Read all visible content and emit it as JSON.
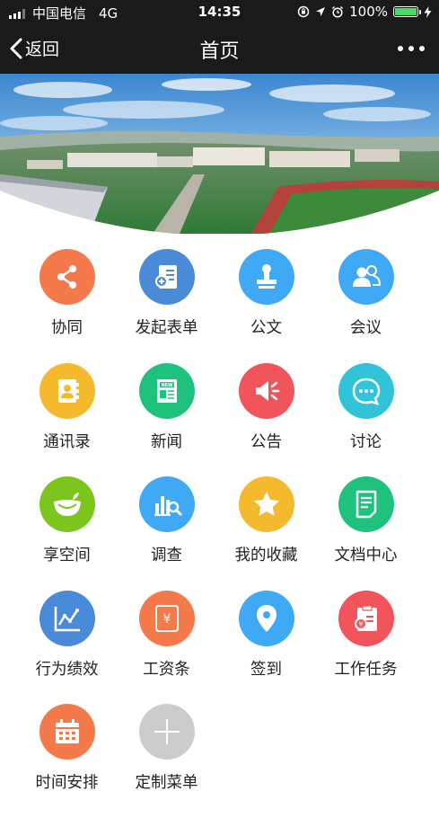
{
  "status": {
    "carrier": "中国电信",
    "network": "4G",
    "time": "14:35",
    "battery": "100%",
    "battery_level": 1.0
  },
  "nav": {
    "back_label": "返回",
    "title": "首页"
  },
  "colors": {
    "bar": "#1a1a1a",
    "battery_fill": "#4cd964"
  },
  "apps": [
    {
      "label": "协同",
      "icon": "share-icon",
      "color": "#f47a4b"
    },
    {
      "label": "发起表单",
      "icon": "form-icon",
      "color": "#4a8bd9"
    },
    {
      "label": "公文",
      "icon": "stamp-icon",
      "color": "#3fa9f5"
    },
    {
      "label": "会议",
      "icon": "people-icon",
      "color": "#3fa9f5"
    },
    {
      "label": "通讯录",
      "icon": "contacts-icon",
      "color": "#f5b92e"
    },
    {
      "label": "新闻",
      "icon": "news-icon",
      "color": "#1ec27d"
    },
    {
      "label": "公告",
      "icon": "megaphone-icon",
      "color": "#f2545b"
    },
    {
      "label": "讨论",
      "icon": "chat-icon",
      "color": "#31c3d9"
    },
    {
      "label": "享空间",
      "icon": "space-icon",
      "color": "#7cc51c"
    },
    {
      "label": "调查",
      "icon": "survey-icon",
      "color": "#3fa9f5"
    },
    {
      "label": "我的收藏",
      "icon": "star-icon",
      "color": "#f5b92e"
    },
    {
      "label": "文档中心",
      "icon": "document-icon",
      "color": "#1ec27d"
    },
    {
      "label": "行为绩效",
      "icon": "performance-icon",
      "color": "#4a8bd9"
    },
    {
      "label": "工资条",
      "icon": "salary-icon",
      "color": "#f47a4b"
    },
    {
      "label": "签到",
      "icon": "location-icon",
      "color": "#3fa9f5"
    },
    {
      "label": "工作任务",
      "icon": "task-icon",
      "color": "#f2545b"
    },
    {
      "label": "时间安排",
      "icon": "calendar-icon",
      "color": "#f47a4b"
    },
    {
      "label": "定制菜单",
      "icon": "plus-icon",
      "color": "#cccccc"
    }
  ]
}
